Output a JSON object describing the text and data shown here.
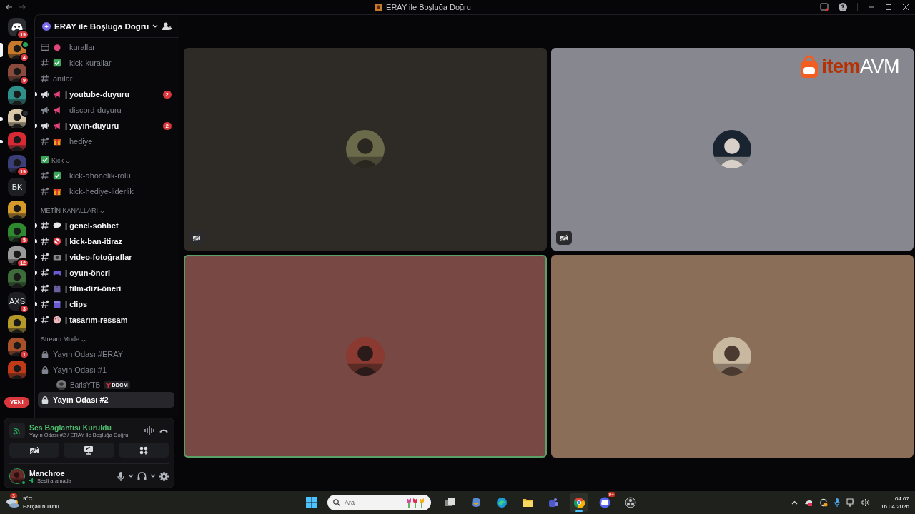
{
  "window": {
    "title": "ERAY ile Boşluğa Doğru"
  },
  "servers": [
    {
      "kind": "home",
      "badge": "19",
      "selected": false,
      "unread": false,
      "voice": false
    },
    {
      "kind": "picture",
      "color": "#c7782a",
      "badge": "4",
      "selected": true,
      "unread": false,
      "voice": true
    },
    {
      "kind": "picture",
      "color": "#8a4b3c",
      "badge": "9",
      "selected": false,
      "unread": false,
      "voice": false
    },
    {
      "kind": "picture",
      "color": "#2f8f8a",
      "selected": false,
      "unread": false,
      "voice": false
    },
    {
      "kind": "picture",
      "color": "#d8c8a8",
      "selected": false,
      "unread": true,
      "voice": true
    },
    {
      "kind": "picture",
      "color": "#d82a35",
      "selected": false,
      "unread": true,
      "voice": false
    },
    {
      "kind": "picture",
      "color": "#3a3f7a",
      "badge": "19",
      "selected": false,
      "unread": false,
      "voice": false
    },
    {
      "kind": "text",
      "label": "BK",
      "selected": false,
      "unread": false,
      "voice": false
    },
    {
      "kind": "picture",
      "color": "#d49a2a",
      "selected": false,
      "unread": false,
      "voice": false
    },
    {
      "kind": "picture",
      "color": "#2f8a2f",
      "badge": "5",
      "selected": false,
      "unread": false,
      "voice": false
    },
    {
      "kind": "picture",
      "color": "#9a9a9a",
      "badge": "12",
      "selected": false,
      "unread": false,
      "voice": false
    },
    {
      "kind": "picture",
      "color": "#3d6b3a",
      "selected": false,
      "unread": false,
      "voice": false
    },
    {
      "kind": "text",
      "label": "AXS",
      "badge": "3",
      "selected": false,
      "unread": false,
      "voice": false
    },
    {
      "kind": "picture",
      "color": "#b59a2a",
      "selected": false,
      "unread": false,
      "voice": false
    },
    {
      "kind": "picture",
      "color": "#a8502a",
      "badge": "1",
      "selected": false,
      "unread": false,
      "voice": false
    },
    {
      "kind": "picture",
      "color": "#c03a1a",
      "selected": false,
      "unread": false,
      "voice": false
    }
  ],
  "new_badge": "YENİ",
  "server_header": {
    "name": "ERAY ile Boşluğa Doğru"
  },
  "sections": [
    {
      "channels": [
        {
          "kind": "rules",
          "emoji": {
            "kind": "ball"
          },
          "name": "| kurallar",
          "unread": false
        },
        {
          "kind": "text",
          "emoji": {
            "kind": "check"
          },
          "name": "| kick-kurallar",
          "unread": false
        },
        {
          "kind": "text",
          "name": "anılar",
          "unread": false
        },
        {
          "kind": "announcement",
          "emoji": {
            "kind": "megaphone"
          },
          "name": "| youtube-duyuru",
          "unread": true,
          "badge": "2"
        },
        {
          "kind": "announcement",
          "emoji": {
            "kind": "megaphone"
          },
          "name": "| discord-duyuru",
          "unread": false
        },
        {
          "kind": "announcement",
          "emoji": {
            "kind": "megaphone"
          },
          "name": "| yayın-duyuru",
          "unread": true,
          "badge": "2"
        },
        {
          "kind": "threads",
          "emoji": {
            "kind": "gift"
          },
          "name": "| hediye",
          "unread": false
        }
      ]
    },
    {
      "category": {
        "label": "Kick",
        "emoji": {
          "kind": "check"
        }
      },
      "channels": [
        {
          "kind": "threads",
          "emoji": {
            "kind": "check"
          },
          "name": "| kick-abonelik-rolü",
          "unread": false
        },
        {
          "kind": "threads",
          "emoji": {
            "kind": "gift"
          },
          "name": "| kick-hediye-liderlik",
          "unread": false
        }
      ]
    },
    {
      "category": {
        "label": "METİN KANALLARI"
      },
      "channels": [
        {
          "kind": "text",
          "emoji": {
            "kind": "speech"
          },
          "name": "| genel-sohbet",
          "unread": true
        },
        {
          "kind": "text",
          "emoji": {
            "kind": "forbidden"
          },
          "name": "| kick-ban-itiraz",
          "unread": true
        },
        {
          "kind": "threads",
          "emoji": {
            "kind": "camera"
          },
          "name": "| video-fotoğraflar",
          "unread": true
        },
        {
          "kind": "threads",
          "emoji": {
            "kind": "gamepad"
          },
          "name": "| oyun-öneri",
          "unread": true
        },
        {
          "kind": "threads",
          "emoji": {
            "kind": "film"
          },
          "name": "| film-dizi-öneri",
          "unread": true
        },
        {
          "kind": "threads",
          "emoji": {
            "kind": "clapper"
          },
          "name": "| clips",
          "unread": true
        },
        {
          "kind": "threads",
          "emoji": {
            "kind": "palette"
          },
          "name": "| tasarım-ressam",
          "unread": true
        }
      ]
    },
    {
      "category": {
        "label": "Stream Mode"
      },
      "channels": [
        {
          "kind": "locked-voice",
          "name": "Yayın Odası #ERAY",
          "unread": false,
          "selected": false
        },
        {
          "kind": "locked-voice",
          "name": "Yayın Odası #1",
          "unread": false,
          "selected": false,
          "users": [
            {
              "name": "BarisYTB",
              "tag": "DDCM"
            }
          ]
        },
        {
          "kind": "locked-voice",
          "name": "Yayın Odası #2",
          "unread": false,
          "selected": true
        }
      ]
    }
  ],
  "voice_panel": {
    "status": "Ses Bağlantısı Kuruldu",
    "location": "Yayın Odası #2 / ERAY ile Boşluğa Doğru"
  },
  "user": {
    "name": "Manchroe",
    "activity": "Sesli aramada"
  },
  "tiles": [
    {
      "color": "#2e2b27",
      "speaking": false,
      "video_off": true
    },
    {
      "color": "#878790",
      "speaking": false,
      "video_off": true,
      "logo": {
        "part_1": "item",
        "part_2": "AVM"
      }
    },
    {
      "color": "#784845",
      "speaking": true,
      "video_off": false
    },
    {
      "color": "#8a6e57",
      "speaking": false,
      "video_off": false
    }
  ],
  "taskbar": {
    "weather": {
      "temp": "9°C",
      "desc": "Parçalı bulutlu",
      "badge": "3"
    },
    "search": {
      "placeholder": "Ara"
    },
    "apps": [
      {
        "kind": "taskview",
        "active": false
      },
      {
        "kind": "copilot",
        "active": false
      },
      {
        "kind": "edge",
        "active": false
      },
      {
        "kind": "files",
        "active": false
      },
      {
        "kind": "teams",
        "active": false
      },
      {
        "kind": "chrome",
        "active": true
      },
      {
        "kind": "discord",
        "active": false,
        "badge": "9+"
      },
      {
        "kind": "obs",
        "active": false
      }
    ],
    "clock": {
      "time": "04:07",
      "date": "16.04.2026"
    }
  }
}
